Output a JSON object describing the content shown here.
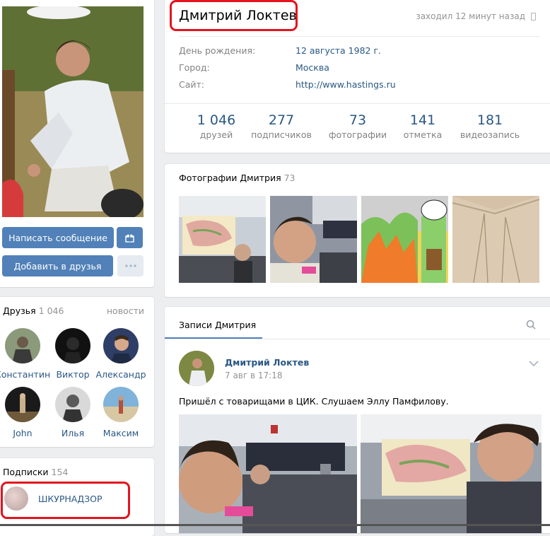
{
  "profile": {
    "name": "Дмитрий Локтев",
    "last_seen": "заходил 12 минут назад",
    "info": [
      {
        "label": "День рождения:",
        "value": "12 августа 1982 г."
      },
      {
        "label": "Город:",
        "value": "Москва"
      },
      {
        "label": "Сайт:",
        "value": "http://www.hastings.ru"
      }
    ],
    "counters": [
      {
        "num": "1 046",
        "label": "друзей"
      },
      {
        "num": "277",
        "label": "подписчиков"
      },
      {
        "num": "73",
        "label": "фотографии"
      },
      {
        "num": "141",
        "label": "отметка"
      },
      {
        "num": "181",
        "label": "видеозапись"
      }
    ]
  },
  "actions": {
    "message_label": "Написать сообщение",
    "add_friend_label": "Добавить в друзья",
    "gift_icon": "gift-icon",
    "more_icon": "more-dots-icon"
  },
  "friends": {
    "title": "Друзья",
    "count": "1 046",
    "link": "новости",
    "items": [
      {
        "name": "Константин"
      },
      {
        "name": "Виктор"
      },
      {
        "name": "Александр"
      },
      {
        "name": "John"
      },
      {
        "name": "Илья"
      },
      {
        "name": "Максим"
      }
    ]
  },
  "subscriptions": {
    "title": "Подписки",
    "count": "154",
    "items": [
      {
        "name": "ШКУРНАДЗОР"
      }
    ]
  },
  "photos": {
    "title": "Фотографии Дмитрия",
    "count": "73"
  },
  "wall": {
    "tab": "Записи Дмитрия",
    "post": {
      "author": "Дмитрий Локтев",
      "date": "7 авг в 17:18",
      "text": "Пришёл с товарищами в ЦИК. Слушаем Эллу Памфилову."
    }
  },
  "colors": {
    "accent": "#5181b8",
    "link": "#2a5885",
    "highlight": "#e3141e"
  }
}
